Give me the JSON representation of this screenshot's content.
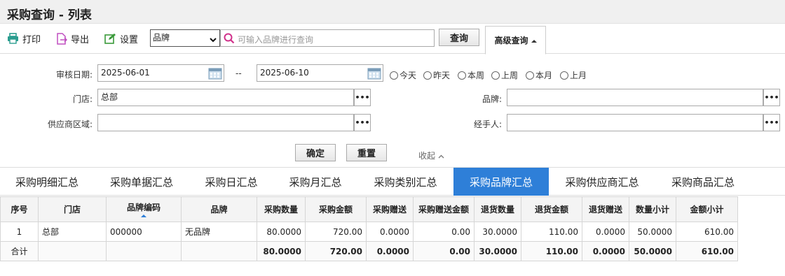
{
  "header": {
    "title": "采购查询 - 列表"
  },
  "toolbar": {
    "print_label": "打印",
    "export_label": "导出",
    "settings_label": "设置",
    "search_field_selected": "品牌",
    "search_placeholder": "可输入品牌进行查询",
    "query_label": "查询",
    "advanced_label": "高级查询"
  },
  "filters": {
    "audit_date_label": "审核日期:",
    "date_from": "2025-06-01",
    "date_sep": "--",
    "date_to": "2025-06-10",
    "quick_ranges": [
      "今天",
      "昨天",
      "本周",
      "上周",
      "本月",
      "上月"
    ],
    "store_label": "门店:",
    "store_value": "总部",
    "brand_label": "品牌:",
    "brand_value": "",
    "supplier_region_label": "供应商区域:",
    "supplier_region_value": "",
    "handler_label": "经手人:",
    "handler_value": "",
    "confirm_label": "确定",
    "reset_label": "重置",
    "collapse_label": "收起"
  },
  "tabs": [
    "采购明细汇总",
    "采购单据汇总",
    "采购日汇总",
    "采购月汇总",
    "采购类别汇总",
    "采购品牌汇总",
    "采购供应商汇总",
    "采购商品汇总"
  ],
  "active_tab": "采购品牌汇总",
  "colors": {
    "accent": "#2e7fd8",
    "print_icon": "#2a9d8f",
    "export_icon": "#c04fc0",
    "settings_icon": "#3a9a3a",
    "search_icon": "#d0308a"
  },
  "table": {
    "columns": [
      "序号",
      "门店",
      "品牌编码",
      "品牌",
      "采购数量",
      "采购金额",
      "采购赠送",
      "采购赠送金额",
      "退货数量",
      "退货金额",
      "退货赠送",
      "数量小计",
      "金额小计"
    ],
    "rows": [
      [
        "1",
        "总部",
        "000000",
        "无品牌",
        "80.0000",
        "720.00",
        "0.0000",
        "0.00",
        "30.0000",
        "110.00",
        "0.0000",
        "50.0000",
        "610.00"
      ]
    ],
    "summary": [
      "合计",
      "",
      "",
      "",
      "80.0000",
      "720.00",
      "0.0000",
      "0.00",
      "30.0000",
      "110.00",
      "0.0000",
      "50.0000",
      "610.00"
    ]
  }
}
